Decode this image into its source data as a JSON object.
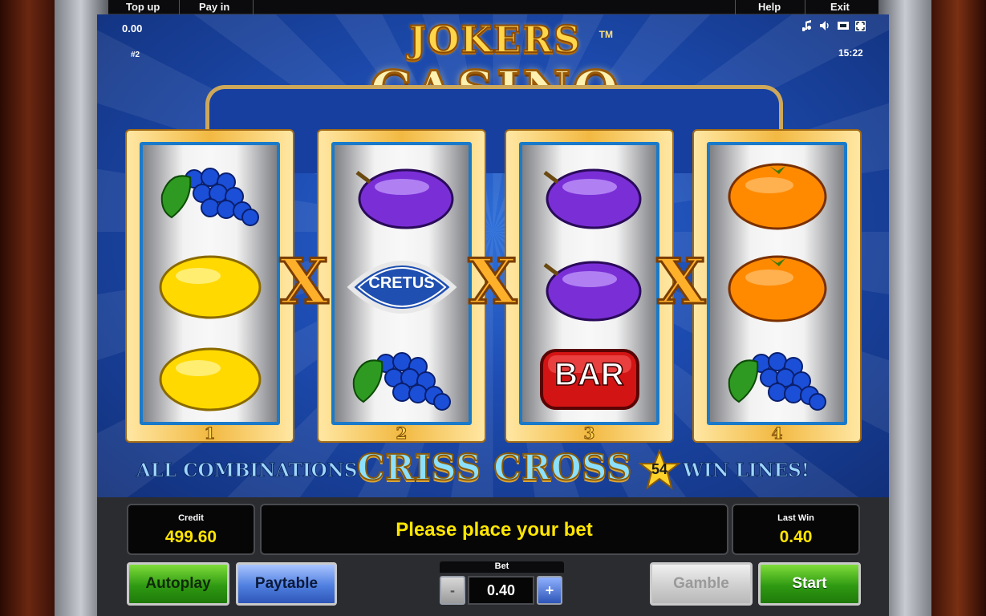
{
  "topbar": {
    "top_up": "Top up",
    "pay_in": "Pay in",
    "help": "Help",
    "exit": "Exit"
  },
  "hud": {
    "balance": "0.00",
    "game_id": "#2",
    "clock": "15:22"
  },
  "icons": [
    "music-note-icon",
    "speaker-icon",
    "screen-icon",
    "fullscreen-icon"
  ],
  "logo": {
    "line1": "JOKERS",
    "line2": "CASINO",
    "tm": "TM"
  },
  "reels": [
    {
      "number": "1",
      "symbols": [
        "grapes",
        "lemon",
        "lemon"
      ]
    },
    {
      "number": "2",
      "symbols": [
        "plum",
        "cretus",
        "grapes"
      ]
    },
    {
      "number": "3",
      "symbols": [
        "plum",
        "plum",
        "bar"
      ]
    },
    {
      "number": "4",
      "symbols": [
        "orange",
        "orange",
        "grapes"
      ]
    }
  ],
  "symbol_text": {
    "cretus": "CRETUS",
    "bar": "BAR"
  },
  "cross_mark": "X",
  "tagline": {
    "left": "ALL COMBINATIONS",
    "center": "CRISS CROSS",
    "lines": "54",
    "right": "WIN LINES!"
  },
  "console": {
    "credit_label": "Credit",
    "credit_value": "499.60",
    "message": "Please place your bet",
    "lastwin_label": "Last Win",
    "lastwin_value": "0.40"
  },
  "buttons": {
    "autoplay": "Autoplay",
    "paytable": "Paytable",
    "gamble": "Gamble",
    "start": "Start"
  },
  "bet": {
    "label": "Bet",
    "value": "0.40",
    "minus": "-",
    "plus": "+"
  },
  "colors": {
    "gold": "#ffd54a",
    "screen_blue": "#1d4db3",
    "display_yellow": "#ffe600",
    "green_button": "#2f9a12",
    "blue_button": "#4f7fe0"
  }
}
